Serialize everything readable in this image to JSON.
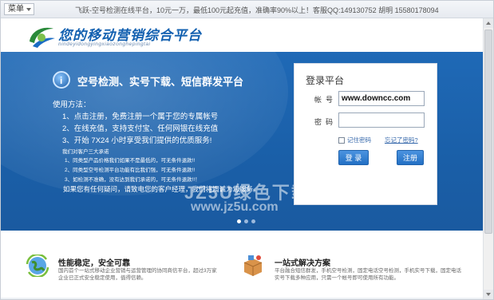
{
  "topbar": {
    "menu_label": "菜单",
    "ticker": "飞跃-空号检测在线平台，10元一万，最低100元起充值，准确率90%以上！客服QQ:149130752   胡明 15580178094"
  },
  "header": {
    "logo_title": "您的移动营销综合平台",
    "logo_subtitle": "nindeyidongyingxiaozonghepingtai"
  },
  "banner": {
    "title": "空号检测、实号下载、短信群发平台",
    "usage_title": "使用方法：",
    "steps": [
      "1、点击注册，免费注册一个属于您的专属帐号",
      "2、在线充值，支持支付宝、任何网银在线充值",
      "3、开始 7X24 小时享受我们提供的优质服务!"
    ],
    "commitment_title": "我们对客户三大承诺",
    "commitments": [
      "1、同类型产品价格我们如果不是最低的，可无条件退款!!",
      "2、同类型空号检测平台功能有比我们强，可无条件退款!!",
      "3、如检测不准确，没有达到我们承诺的，可无条件退款!!！"
    ],
    "contact": "如果您有任何疑问，请致电您的客户经理，我们将竭诚为您服务。"
  },
  "login": {
    "title": "登录平台",
    "username_label": "帐号",
    "username_value": "www.downcc.com",
    "password_label": "密码",
    "password_value": "",
    "remember_label": "记住密码",
    "forgot_label": "忘记了密码?",
    "login_button": "登 录",
    "register_button": "注册"
  },
  "watermark": {
    "line1": "JZ5U绿色下载",
    "line2": "www.jz5u.com"
  },
  "features": [
    {
      "title": "性能稳定，安全可靠",
      "desc": "国内首个一站式移动企业营销与运营管理的协同商信平台，超过3万家企业已正式安全稳定使用，值得信赖。"
    },
    {
      "title": "一站式解决方案",
      "desc": "平台融合短信群发，手机空号检测，固定电话空号检测，手机实号下载，固定电话实号下载多种应用，只需一个帐号即可使用所有功能。"
    }
  ],
  "colors": {
    "banner_blue": "#1f69b6",
    "brand_blue": "#1260b0",
    "button_blue": "#2f80d4"
  }
}
